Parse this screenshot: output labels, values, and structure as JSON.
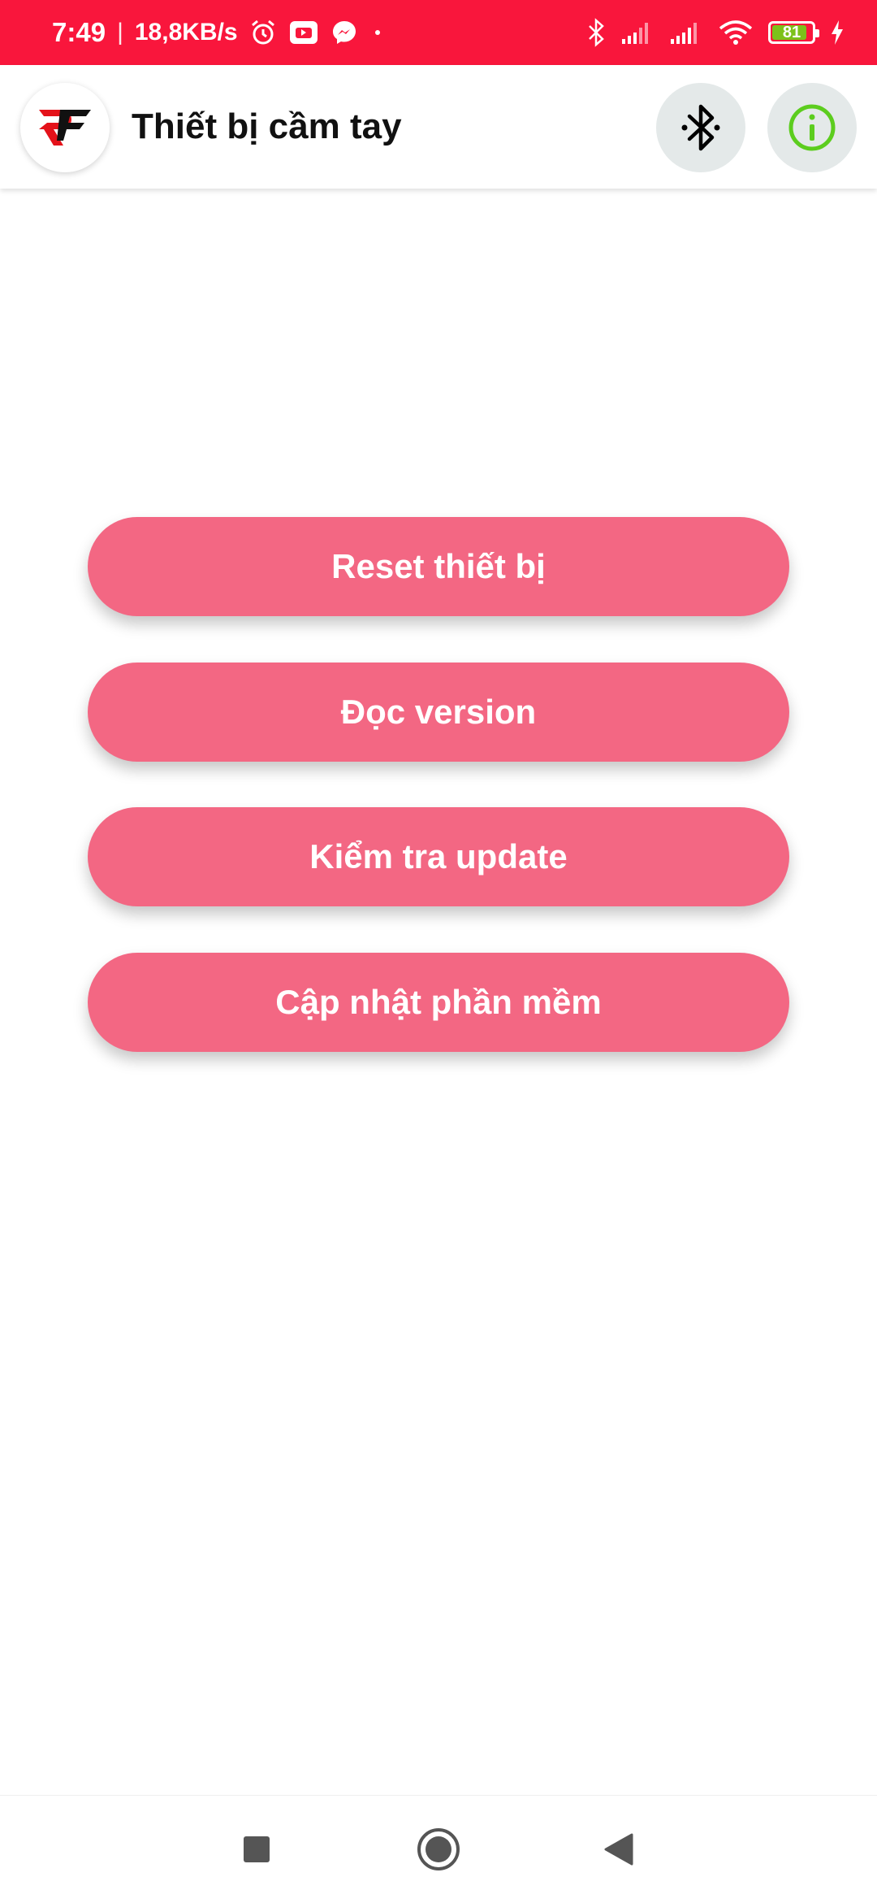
{
  "status_bar": {
    "time": "7:49",
    "separator": "|",
    "speed": "18,8KB/s",
    "battery_level": "81",
    "icons": [
      "alarm-icon",
      "youtube-icon",
      "messenger-icon",
      "dot-icon",
      "bluetooth-icon",
      "signal-icon",
      "signal-icon",
      "wifi-icon",
      "battery-icon",
      "charging-icon"
    ]
  },
  "app_bar": {
    "logo_icon": "rf-logo-icon",
    "title": "Thiết bị cầm tay",
    "bluetooth_icon": "bluetooth-icon",
    "info_icon": "info-icon"
  },
  "actions": [
    {
      "label": "Reset thiết bị"
    },
    {
      "label": "Đọc version"
    },
    {
      "label": "Kiểm tra update"
    },
    {
      "label": "Cập nhật phần mềm"
    }
  ],
  "nav_bar": {
    "icons": [
      "recent-apps-icon",
      "home-icon",
      "back-icon"
    ]
  },
  "colors": {
    "status_bar": "#f9163c",
    "button": "#f36783",
    "icon_button_bg": "#e4e9e9",
    "info_green": "#5ccd1e",
    "battery_green": "#7cc11a"
  }
}
